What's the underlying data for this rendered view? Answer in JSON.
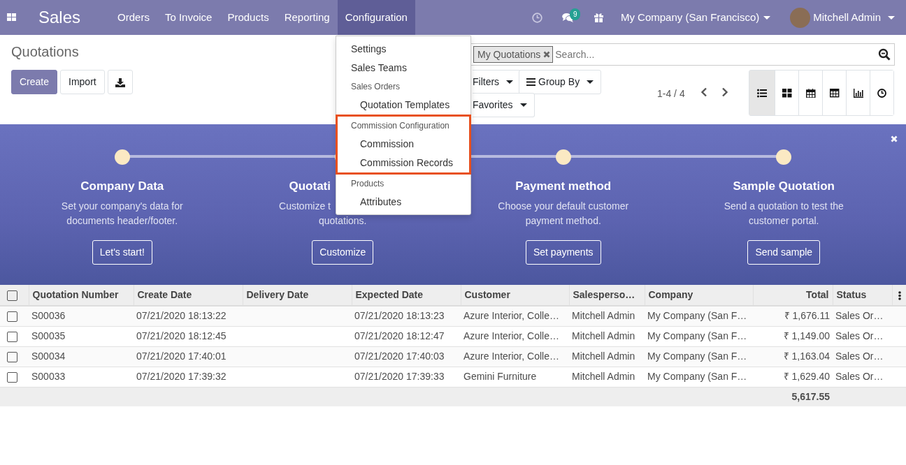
{
  "navbar": {
    "app_name": "Sales",
    "menu": [
      {
        "label": "Orders",
        "selected": false
      },
      {
        "label": "To Invoice",
        "selected": false
      },
      {
        "label": "Products",
        "selected": false
      },
      {
        "label": "Reporting",
        "selected": false
      },
      {
        "label": "Configuration",
        "selected": true
      }
    ],
    "message_count": "9",
    "company": "My Company (San Francisco)",
    "user": "Mitchell Admin"
  },
  "config_menu": {
    "groups": [
      {
        "highlighted": false,
        "entries": [
          {
            "kind": "item",
            "label": "Settings"
          },
          {
            "kind": "item",
            "label": "Sales Teams"
          },
          {
            "kind": "header",
            "label": "Sales Orders"
          },
          {
            "kind": "subitem",
            "label": "Quotation Templates"
          }
        ]
      },
      {
        "highlighted": true,
        "entries": [
          {
            "kind": "header",
            "label": "Commission Configuration"
          },
          {
            "kind": "subitem",
            "label": "Commission"
          },
          {
            "kind": "subitem",
            "label": "Commission Records"
          }
        ]
      },
      {
        "highlighted": false,
        "entries": [
          {
            "kind": "header",
            "label": "Products"
          },
          {
            "kind": "subitem",
            "label": "Attributes"
          }
        ]
      }
    ]
  },
  "control_panel": {
    "title": "Quotations",
    "buttons": [
      "Create",
      "Import"
    ],
    "search": {
      "facet": "My Quotations",
      "placeholder": "Search..."
    },
    "filters": [
      {
        "label": "Filters",
        "kind": "partial"
      },
      {
        "label": "Group By",
        "kind": "full"
      },
      {
        "label": "Favorites",
        "kind": "partial"
      }
    ],
    "pager": "1-4 / 4",
    "views": [
      {
        "kind": "list",
        "selected": true
      },
      {
        "kind": "kanban",
        "selected": false
      },
      {
        "kind": "calendar",
        "selected": false
      },
      {
        "kind": "pivot",
        "selected": false
      },
      {
        "kind": "graph",
        "selected": false
      },
      {
        "kind": "activity",
        "selected": false
      }
    ]
  },
  "onboarding": {
    "steps": [
      {
        "kind": "full",
        "title": "Company Data",
        "lines": [
          "Set your company's data for",
          "documents header/footer."
        ],
        "button": "Let's start!"
      },
      {
        "kind": "partial",
        "title": "Quotati",
        "lines": [
          "Customize t",
          "quotations."
        ],
        "button": "Customize"
      },
      {
        "kind": "full",
        "title": "Payment method",
        "lines": [
          "Choose your default customer",
          "payment method."
        ],
        "button": "Set payments"
      },
      {
        "kind": "full",
        "title": "Sample Quotation",
        "lines": [
          "Send a quotation to test the",
          "customer portal."
        ],
        "button": "Send sample"
      }
    ]
  },
  "table": {
    "header_checked": false,
    "columns": [
      "Quotation Number",
      "Create Date",
      "Delivery Date",
      "Expected Date",
      "Customer",
      "Salesperso…",
      "Company",
      "Total",
      "Status"
    ],
    "rows": [
      {
        "checked": false,
        "cells": [
          "S00036",
          "07/21/2020 18:13:22",
          "",
          "07/21/2020 18:13:23",
          "Azure Interior, Colle…",
          "Mitchell Admin",
          "My Company (San F…",
          "₹ 1,676.11",
          "Sales Or…"
        ]
      },
      {
        "checked": false,
        "cells": [
          "S00035",
          "07/21/2020 18:12:45",
          "",
          "07/21/2020 18:12:47",
          "Azure Interior, Colle…",
          "Mitchell Admin",
          "My Company (San F…",
          "₹ 1,149.00",
          "Sales Or…"
        ]
      },
      {
        "checked": false,
        "cells": [
          "S00034",
          "07/21/2020 17:40:01",
          "",
          "07/21/2020 17:40:03",
          "Azure Interior, Colle…",
          "Mitchell Admin",
          "My Company (San F…",
          "₹ 1,163.04",
          "Sales Or…"
        ]
      },
      {
        "checked": false,
        "cells": [
          "S00033",
          "07/21/2020 17:39:32",
          "",
          "07/21/2020 17:39:33",
          "Gemini Furniture",
          "Mitchell Admin",
          "My Company (San F…",
          "₹ 1,629.40",
          "Sales Or…"
        ]
      }
    ],
    "total": "5,617.55"
  }
}
